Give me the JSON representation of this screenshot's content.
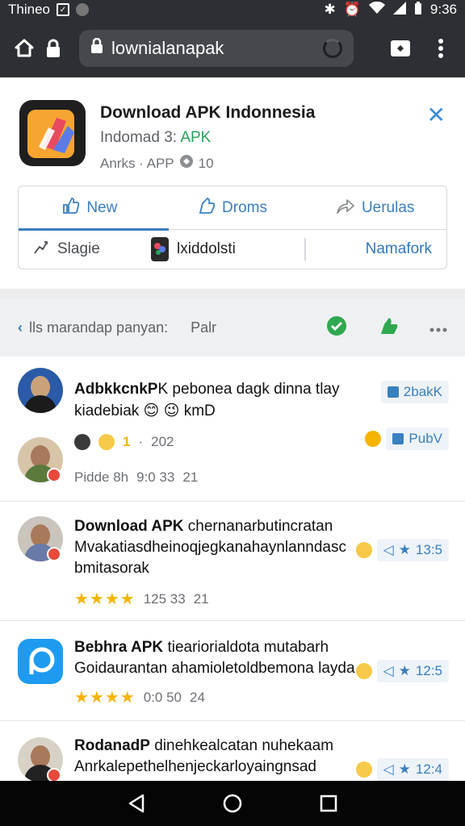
{
  "status_bar": {
    "left_text": "Thineo",
    "time": "9:36"
  },
  "browser": {
    "url": "lownialanapak"
  },
  "app": {
    "title": "Download APK Indonnesia",
    "subtitle_prefix": "Indomad 3:",
    "subtitle_apk": "APK",
    "meta_text": "Anrks · APP",
    "rating": "10",
    "icon_colors": [
      "#f7a531",
      "#e84a5f",
      "#5b7ce6"
    ]
  },
  "tabs": [
    {
      "label": "New",
      "icon": "thumbs-up-icon",
      "active": true
    },
    {
      "label": "Droms",
      "icon": "thumbs-up-icon",
      "active": false
    },
    {
      "label": "Uerulas",
      "icon": "share-icon",
      "active": false
    }
  ],
  "subtabs": {
    "slage": "Slagie",
    "kid": "lxiddolsti",
    "namafork": "Namafork"
  },
  "filter": {
    "text": "lls marandap panyan:",
    "extra": "Palr"
  },
  "feed": [
    {
      "title_bold": "AdbkkcnkP",
      "title_rest": "K pebonea dagk dinna tlay",
      "line2": "kiadebiak 😊 😉 kmD",
      "meta_label": "202",
      "meta_count": "1",
      "date": "Pidde 8h",
      "time": "9:0 33",
      "count": "21",
      "action1": "2bakK",
      "action2": "PubV"
    },
    {
      "title_bold": "Download APK",
      "title_rest": "chernanarbutincratan",
      "line2": "Mvakatiasdheinoqjegkanahaynlanndasc",
      "line3": "bmitasorak",
      "time": "125 33",
      "count": "21",
      "side_count": "13:5"
    },
    {
      "title_bold": "Bebhra APK",
      "title_rest": "tieariorialdota mutabarh",
      "line2": "Goidaurantan ahamioletoldbemona layda.",
      "time": "0:0 50",
      "count": "24",
      "side_count": "12:5"
    },
    {
      "title_bold": "RodanadP",
      "title_rest": "dinehkealcatan nuhekaam",
      "line2": "Anrkalepethelhenjeckarloyaingnsad",
      "side_count": "12:4"
    }
  ],
  "colors": {
    "accent": "#3a7fc0",
    "apk_green": "#26a65b",
    "star": "#f4b400",
    "green_icon": "#2fa84f"
  }
}
